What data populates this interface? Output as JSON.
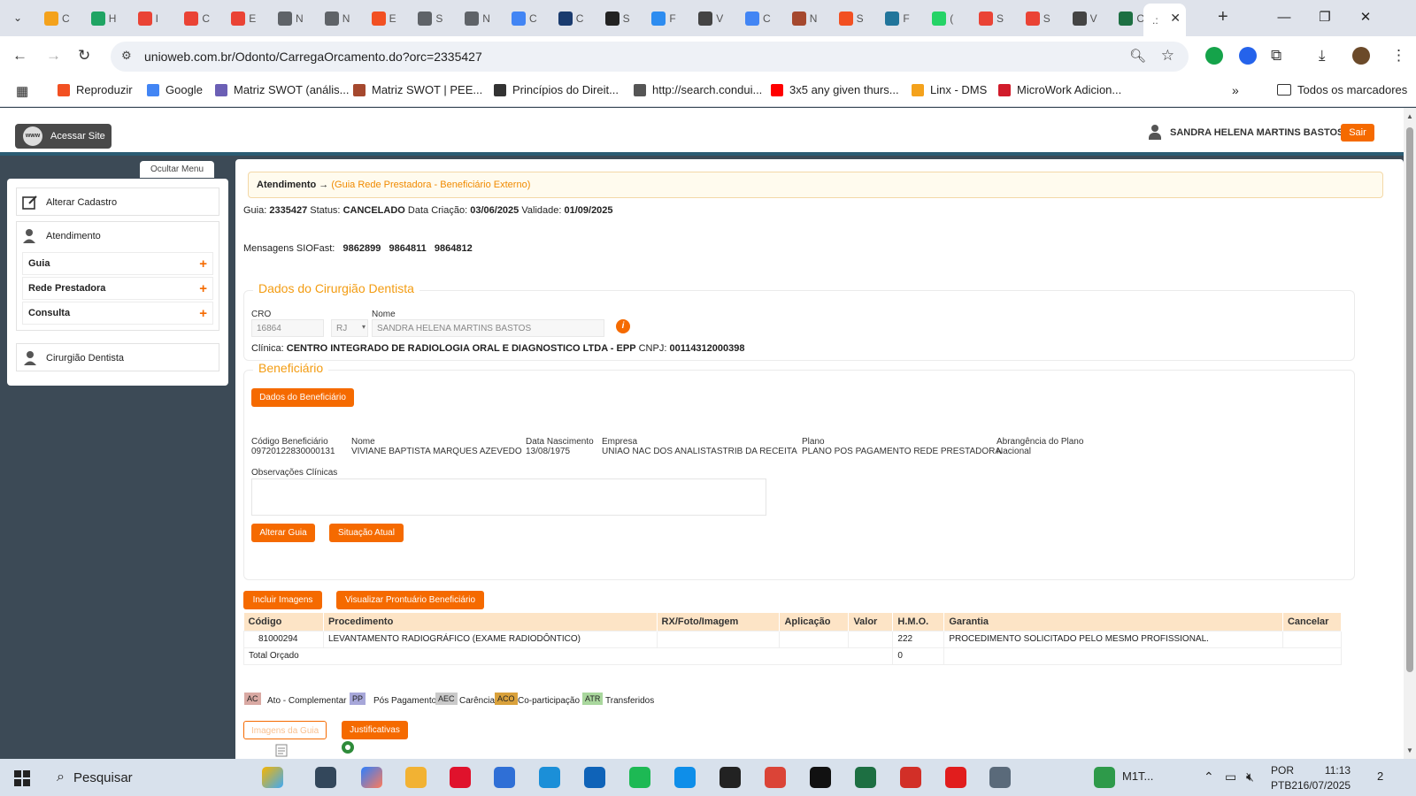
{
  "browser": {
    "tabs_count_note_free": true,
    "tabs": [
      {
        "label": "C",
        "color": "#f4a21c"
      },
      {
        "label": "H",
        "color": "#1fa463"
      },
      {
        "label": "I",
        "color": "#ea4335"
      },
      {
        "label": "C",
        "color": "#ea4335"
      },
      {
        "label": "E",
        "color": "#ea4335"
      },
      {
        "label": "N",
        "color": "#5f6368"
      },
      {
        "label": "N",
        "color": "#5f6368"
      },
      {
        "label": "E",
        "color": "#f25022"
      },
      {
        "label": "S",
        "color": "#5f6368"
      },
      {
        "label": "N",
        "color": "#5f6368"
      },
      {
        "label": "C",
        "color": "#4285f4"
      },
      {
        "label": "C",
        "color": "#1a3b6e"
      },
      {
        "label": "S",
        "color": "#222222"
      },
      {
        "label": "F",
        "color": "#2d8cf0"
      },
      {
        "label": "V",
        "color": "#444444"
      },
      {
        "label": "C",
        "color": "#4285f4"
      },
      {
        "label": "N",
        "color": "#a5482e"
      },
      {
        "label": "S",
        "color": "#f25022"
      },
      {
        "label": "F",
        "color": "#21759b"
      },
      {
        "label": "(",
        "color": "#25d366"
      },
      {
        "label": "S",
        "color": "#ea4335"
      },
      {
        "label": "S",
        "color": "#ea4335"
      },
      {
        "label": "V",
        "color": "#444444"
      },
      {
        "label": "C",
        "color": "#1d6f42"
      }
    ],
    "active_tab": {
      "label": ".:",
      "close": "✕"
    },
    "new_tab": "+",
    "window_controls": {
      "minimize": "—",
      "maximize": "❐",
      "close": "✕"
    },
    "url": "unioweb.com.br/Odonto/CarregaOrcamento.do?orc=2335427",
    "bookmarks": [
      {
        "label": "Reproduzir",
        "color": "#f25022"
      },
      {
        "label": "Google",
        "color": "#4285f4"
      },
      {
        "label": "Matriz SWOT (anális...",
        "color": "#6b5fb5"
      },
      {
        "label": "Matriz SWOT | PEE...",
        "color": "#a5482e"
      },
      {
        "label": "Princípios do Direit...",
        "color": "#333333"
      },
      {
        "label": "http://search.condui...",
        "color": "#555555"
      },
      {
        "label": "3x5 any given thurs...",
        "color": "#ff0000"
      },
      {
        "label": "Linx - DMS",
        "color": "#f4a21c"
      },
      {
        "label": "MicroWork Adicion...",
        "color": "#d11c2b"
      }
    ],
    "bookmarks_more": "»",
    "all_bookmarks": "Todos os marcadores"
  },
  "header": {
    "site_button": "Acessar Site",
    "www": "www",
    "user_name": "SANDRA HELENA MARTINS BASTOS",
    "logout": "Sair"
  },
  "sidebar": {
    "hide_menu": "Ocultar Menu",
    "alterar_cadastro": "Alterar Cadastro",
    "atendimento": "Atendimento",
    "items": [
      {
        "label": "Guia",
        "plus": "+"
      },
      {
        "label": "Rede Prestadora",
        "plus": "+"
      },
      {
        "label": "Consulta",
        "plus": "+"
      }
    ],
    "cirurgiao": "Cirurgião Dentista"
  },
  "main": {
    "breadcrumb_main": "Atendimento",
    "breadcrumb_arrow": "→",
    "breadcrumb_sub": "(Guia Rede Prestadora - Beneficiário Externo)",
    "guia_label": "Guia:",
    "guia_value": "2335427",
    "status_label": "Status:",
    "status_value": "CANCELADO",
    "data_criacao_label": "Data Criação:",
    "data_criacao_value": "03/06/2025",
    "validade_label": "Validade:",
    "validade_value": "01/09/2025",
    "siofast_label": "Mensagens SIOFast:",
    "siofast_values": [
      "9862899",
      "9864811",
      "9864812"
    ],
    "dentista": {
      "legend": "Dados do Cirurgião Dentista",
      "cro_label": "CRO",
      "cro_value": "16864",
      "uf_value": "RJ",
      "nome_label": "Nome",
      "nome_value": "SANDRA HELENA MARTINS BASTOS",
      "clinica_label": "Clínica:",
      "clinica_value": "CENTRO INTEGRADO DE RADIOLOGIA ORAL E DIAGNOSTICO LTDA - EPP",
      "cnpj_label": "CNPJ:",
      "cnpj_value": "00114312000398"
    },
    "beneficiario": {
      "legend": "Beneficiário",
      "dados_button": "Dados do Beneficiário",
      "columns": [
        {
          "label": "Código Beneficiário",
          "value": "09720122830000131"
        },
        {
          "label": "Nome",
          "value": "VIVIANE BAPTISTA MARQUES AZEVEDO"
        },
        {
          "label": "Data Nascimento",
          "value": "13/08/1975"
        },
        {
          "label": "Empresa",
          "value": "UNIAO NAC DOS ANALISTASTRIB DA RECEITA"
        },
        {
          "label": "Plano",
          "value": "PLANO POS PAGAMENTO REDE PRESTADORA"
        },
        {
          "label": "Abrangência do Plano",
          "value": "Nacional"
        }
      ],
      "obs_label": "Observações Clínicas",
      "alterar_guia": "Alterar Guia",
      "situacao_atual": "Situação Atual"
    },
    "incluir_imagens": "Incluir Imagens",
    "visualizar_prontuario": "Visualizar Prontuário Beneficiário",
    "table": {
      "headers": [
        "Código",
        "Procedimento",
        "RX/Foto/Imagem",
        "Aplicação",
        "Valor",
        "H.M.O.",
        "Garantia",
        "Cancelar"
      ],
      "rows": [
        [
          "81000294",
          "LEVANTAMENTO RADIOGRÁFICO (EXAME RADIODÔNTICO)",
          "",
          "",
          "",
          "222",
          "PROCEDIMENTO SOLICITADO PELO MESMO PROFISSIONAL.",
          ""
        ]
      ],
      "total_label": "Total Orçado",
      "total_hmo": "0"
    },
    "legend_tags": [
      {
        "tag": "AC",
        "label": "Ato - Complementar",
        "color": "#d9a9a3"
      },
      {
        "tag": "PP",
        "label": "Pós Pagamento",
        "color": "#a7a7d9"
      },
      {
        "tag": "AEC",
        "label": "Carência",
        "color": "#c9c9c9"
      },
      {
        "tag": "ACO",
        "label": "Co-participação",
        "color": "#d9a13b"
      },
      {
        "tag": "ATR",
        "label": "Transferidos",
        "color": "#a9d79d"
      }
    ],
    "imagens_guia": "Imagens da Guia",
    "justificativas": "Justificativas"
  },
  "taskbar": {
    "search_placeholder": "Pesquisar",
    "tray_app": "M1T...",
    "lang1": "POR",
    "lang2": "PTB2",
    "time": "11:13",
    "date": "16/07/2025",
    "notif": "2"
  }
}
